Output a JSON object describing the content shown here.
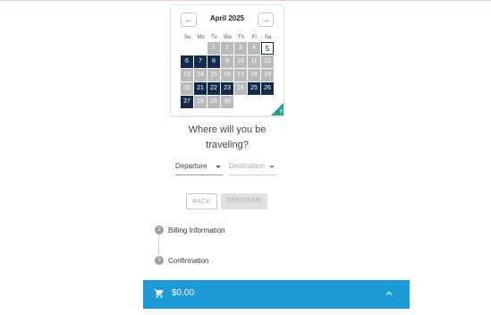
{
  "calendar": {
    "month_label": "April 2025",
    "prev_icon": "←",
    "next_icon": "→",
    "weekdays": [
      "Su",
      "Mo",
      "Tu",
      "We",
      "Th",
      "Fr",
      "Sa"
    ],
    "days": [
      {
        "n": "1",
        "state": "gray"
      },
      {
        "n": "2",
        "state": "gray"
      },
      {
        "n": "3",
        "state": "gray"
      },
      {
        "n": "4",
        "state": "gray"
      },
      {
        "n": "5",
        "state": "selected"
      },
      {
        "n": "6",
        "state": "dark"
      },
      {
        "n": "7",
        "state": "dark"
      },
      {
        "n": "8",
        "state": "dark"
      },
      {
        "n": "9",
        "state": "gray"
      },
      {
        "n": "10",
        "state": "gray"
      },
      {
        "n": "11",
        "state": "gray"
      },
      {
        "n": "12",
        "state": "gray"
      },
      {
        "n": "13",
        "state": "gray"
      },
      {
        "n": "14",
        "state": "gray"
      },
      {
        "n": "15",
        "state": "gray"
      },
      {
        "n": "16",
        "state": "gray"
      },
      {
        "n": "17",
        "state": "gray"
      },
      {
        "n": "18",
        "state": "gray"
      },
      {
        "n": "19",
        "state": "gray"
      },
      {
        "n": "20",
        "state": "gray"
      },
      {
        "n": "21",
        "state": "dark"
      },
      {
        "n": "22",
        "state": "dark"
      },
      {
        "n": "23",
        "state": "dark"
      },
      {
        "n": "24",
        "state": "gray"
      },
      {
        "n": "25",
        "state": "dark"
      },
      {
        "n": "26",
        "state": "dark"
      },
      {
        "n": "27",
        "state": "dark"
      },
      {
        "n": "28",
        "state": "gray"
      },
      {
        "n": "29",
        "state": "gray"
      },
      {
        "n": "30",
        "state": "gray"
      }
    ],
    "help_glyph": "?"
  },
  "question": {
    "line1": "Where will you be",
    "line2": "traveling?"
  },
  "selects": {
    "departure": "Departure",
    "destination": "Destination"
  },
  "buttons": {
    "back": "BACK",
    "continue": "CONTINUE"
  },
  "steps": [
    {
      "num": "2",
      "label": "Billing Information"
    },
    {
      "num": "3",
      "label": "Confirmation"
    }
  ],
  "cart": {
    "total": "$0.00",
    "icon": "shopping-cart-icon",
    "toggle_icon": "chevron-up-icon"
  },
  "colors": {
    "accent_blue": "#1b9ad6",
    "day_dark": "#142a4d",
    "day_gray": "#b9babc",
    "corner_green": "#1fa48a"
  }
}
